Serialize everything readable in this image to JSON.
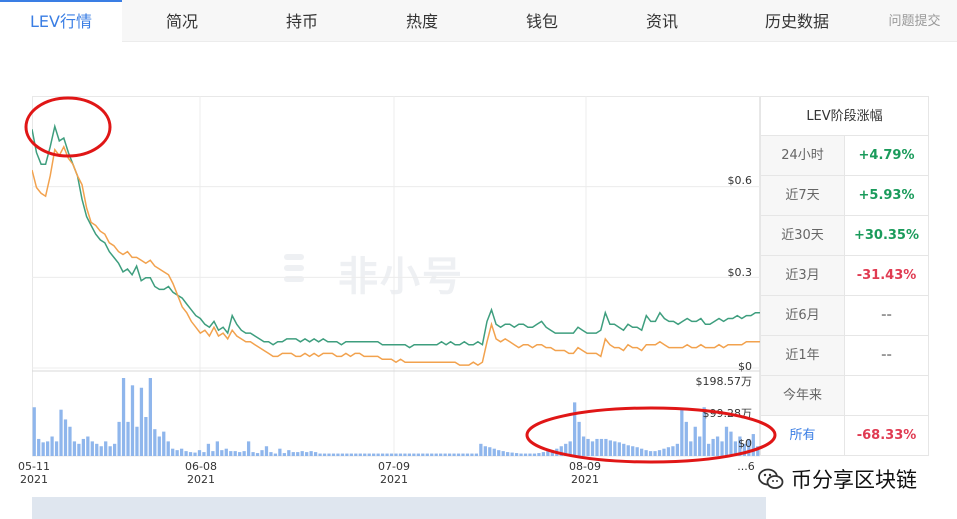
{
  "tabs": [
    {
      "label": "LEV行情",
      "active": true
    },
    {
      "label": "简况"
    },
    {
      "label": "持币"
    },
    {
      "label": "热度"
    },
    {
      "label": "钱包"
    },
    {
      "label": "资讯"
    },
    {
      "label": "历史数据"
    },
    {
      "label": "问题提交"
    }
  ],
  "watermark": "非小号",
  "chart_data": {
    "type": "line",
    "title": "",
    "y_ticks": [
      "$0.6",
      "$0.3",
      "$0"
    ],
    "volume_ticks": [
      "$198.57万",
      "$99.28万",
      "$0"
    ],
    "x_ticks": [
      {
        "date": "05-11",
        "year": "2021"
      },
      {
        "date": "06-08",
        "year": "2021"
      },
      {
        "date": "07-09",
        "year": "2021"
      },
      {
        "date": "08-09",
        "year": "2021"
      },
      {
        "date": "...6",
        "year": ""
      }
    ],
    "ylim": [
      0,
      0.9
    ],
    "series": [
      {
        "color": "#3e9e7e",
        "values": [
          0.82,
          0.74,
          0.7,
          0.7,
          0.76,
          0.83,
          0.78,
          0.79,
          0.74,
          0.7,
          0.66,
          0.58,
          0.52,
          0.49,
          0.46,
          0.44,
          0.43,
          0.4,
          0.38,
          0.36,
          0.33,
          0.34,
          0.32,
          0.35,
          0.3,
          0.31,
          0.31,
          0.28,
          0.27,
          0.27,
          0.28,
          0.26,
          0.25,
          0.24,
          0.22,
          0.2,
          0.18,
          0.17,
          0.15,
          0.14,
          0.16,
          0.13,
          0.14,
          0.12,
          0.18,
          0.15,
          0.13,
          0.12,
          0.12,
          0.11,
          0.1,
          0.09,
          0.09,
          0.08,
          0.09,
          0.09,
          0.1,
          0.1,
          0.1,
          0.09,
          0.1,
          0.09,
          0.1,
          0.09,
          0.1,
          0.09,
          0.09,
          0.09,
          0.08,
          0.09,
          0.09,
          0.09,
          0.09,
          0.09,
          0.09,
          0.09,
          0.09,
          0.08,
          0.08,
          0.08,
          0.08,
          0.08,
          0.08,
          0.07,
          0.08,
          0.08,
          0.08,
          0.08,
          0.08,
          0.08,
          0.09,
          0.08,
          0.09,
          0.08,
          0.08,
          0.09,
          0.08,
          0.08,
          0.09,
          0.08,
          0.16,
          0.2,
          0.15,
          0.14,
          0.15,
          0.15,
          0.14,
          0.15,
          0.15,
          0.14,
          0.14,
          0.15,
          0.16,
          0.14,
          0.13,
          0.12,
          0.12,
          0.12,
          0.12,
          0.12,
          0.14,
          0.13,
          0.12,
          0.12,
          0.12,
          0.13,
          0.19,
          0.15,
          0.15,
          0.14,
          0.13,
          0.15,
          0.14,
          0.14,
          0.13,
          0.18,
          0.16,
          0.16,
          0.19,
          0.17,
          0.16,
          0.16,
          0.15,
          0.16,
          0.17,
          0.16,
          0.16,
          0.17,
          0.15,
          0.15,
          0.16,
          0.17,
          0.16,
          0.17,
          0.17,
          0.18,
          0.17,
          0.18,
          0.18,
          0.19,
          0.19
        ]
      },
      {
        "color": "#f2a24e",
        "values": [
          0.68,
          0.62,
          0.6,
          0.59,
          0.66,
          0.75,
          0.73,
          0.76,
          0.72,
          0.7,
          0.66,
          0.63,
          0.55,
          0.5,
          0.49,
          0.47,
          0.46,
          0.43,
          0.42,
          0.4,
          0.39,
          0.4,
          0.38,
          0.38,
          0.37,
          0.36,
          0.37,
          0.35,
          0.34,
          0.33,
          0.32,
          0.29,
          0.25,
          0.21,
          0.19,
          0.16,
          0.14,
          0.12,
          0.13,
          0.11,
          0.14,
          0.11,
          0.12,
          0.1,
          0.13,
          0.11,
          0.1,
          0.09,
          0.09,
          0.08,
          0.07,
          0.06,
          0.05,
          0.04,
          0.04,
          0.05,
          0.05,
          0.05,
          0.04,
          0.04,
          0.05,
          0.04,
          0.05,
          0.04,
          0.05,
          0.05,
          0.05,
          0.04,
          0.04,
          0.05,
          0.04,
          0.05,
          0.05,
          0.04,
          0.04,
          0.04,
          0.04,
          0.03,
          0.03,
          0.03,
          0.02,
          0.03,
          0.02,
          0.02,
          0.02,
          0.02,
          0.02,
          0.02,
          0.02,
          0.02,
          0.02,
          0.02,
          0.02,
          0.02,
          0.01,
          0.01,
          0.01,
          0.02,
          0.01,
          0.02,
          0.09,
          0.15,
          0.1,
          0.09,
          0.1,
          0.09,
          0.08,
          0.07,
          0.08,
          0.08,
          0.07,
          0.08,
          0.08,
          0.07,
          0.07,
          0.06,
          0.06,
          0.06,
          0.05,
          0.05,
          0.07,
          0.06,
          0.05,
          0.05,
          0.05,
          0.04,
          0.1,
          0.08,
          0.07,
          0.07,
          0.06,
          0.08,
          0.07,
          0.07,
          0.06,
          0.08,
          0.08,
          0.08,
          0.09,
          0.08,
          0.07,
          0.07,
          0.07,
          0.07,
          0.08,
          0.07,
          0.07,
          0.08,
          0.07,
          0.07,
          0.07,
          0.08,
          0.07,
          0.08,
          0.08,
          0.08,
          0.08,
          0.09,
          0.09,
          0.09,
          0.09
        ]
      }
    ],
    "volume_max": 198.57,
    "volume": [
      100,
      35,
      28,
      30,
      40,
      30,
      95,
      75,
      60,
      30,
      25,
      35,
      40,
      30,
      25,
      20,
      30,
      20,
      25,
      70,
      160,
      70,
      145,
      60,
      140,
      80,
      160,
      55,
      40,
      50,
      30,
      15,
      12,
      15,
      10,
      8,
      7,
      12,
      8,
      25,
      10,
      30,
      12,
      15,
      10,
      10,
      8,
      10,
      30,
      8,
      6,
      12,
      20,
      8,
      5,
      15,
      6,
      12,
      8,
      8,
      10,
      8,
      10,
      8,
      5,
      5,
      5,
      5,
      5,
      5,
      5,
      5,
      5,
      5,
      5,
      5,
      5,
      5,
      5,
      5,
      5,
      5,
      5,
      5,
      5,
      5,
      5,
      5,
      5,
      5,
      5,
      5,
      5,
      5,
      5,
      5,
      5,
      5,
      5,
      5,
      25,
      20,
      18,
      15,
      12,
      10,
      8,
      7,
      6,
      5,
      5,
      5,
      5,
      6,
      8,
      10,
      12,
      15,
      20,
      25,
      30,
      110,
      70,
      40,
      35,
      30,
      35,
      35,
      35,
      32,
      30,
      28,
      25,
      22,
      20,
      18,
      15,
      12,
      10,
      10,
      12,
      15,
      18,
      20,
      25,
      95,
      70,
      30,
      60,
      40,
      100,
      25,
      35,
      40,
      30,
      60,
      50,
      30,
      40,
      25,
      35,
      45,
      20
    ]
  },
  "stats": {
    "title": "LEV阶段涨幅",
    "rows": [
      {
        "label": "24小时",
        "value": "+4.79%",
        "color": "#1a9b5b"
      },
      {
        "label": "近7天",
        "value": "+5.93%",
        "color": "#1a9b5b"
      },
      {
        "label": "近30天",
        "value": "+30.35%",
        "color": "#1a9b5b"
      },
      {
        "label": "近3月",
        "value": "-31.43%",
        "color": "#e03b52"
      },
      {
        "label": "近6月",
        "value": "--",
        "color": "#999999"
      },
      {
        "label": "近1年",
        "value": "--",
        "color": "#999999"
      },
      {
        "label": "今年来",
        "value": "",
        "color": "#999999"
      },
      {
        "label": "所有",
        "value": "-68.33%",
        "color": "#e03b52",
        "active": true
      }
    ]
  },
  "wechat": {
    "label": "币分享区块链",
    "icon": "wechat-icon"
  }
}
